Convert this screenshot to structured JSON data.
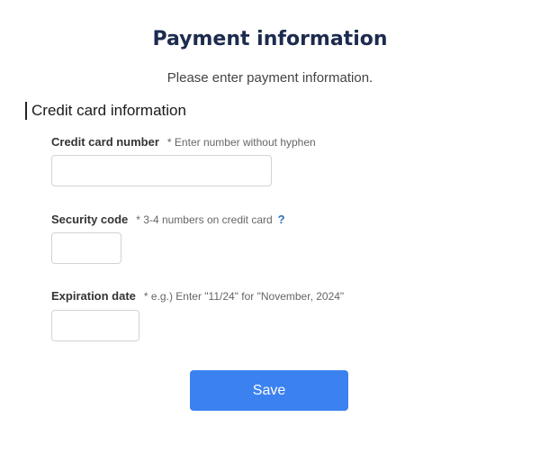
{
  "header": {
    "title": "Payment information",
    "subtitle": "Please enter payment information."
  },
  "section": {
    "heading": "Credit card information"
  },
  "fields": {
    "card_number": {
      "label": "Credit card number",
      "hint": "* Enter number without hyphen",
      "value": "",
      "placeholder": ""
    },
    "security_code": {
      "label": "Security code",
      "hint": "* 3-4 numbers on credit card",
      "help_icon": "?",
      "value": "",
      "placeholder": ""
    },
    "expiration_date": {
      "label": "Expiration date",
      "hint": "* e.g.) Enter \"11/24\" for \"November, 2024\"",
      "value": "",
      "placeholder": ""
    }
  },
  "actions": {
    "save_label": "Save"
  },
  "colors": {
    "title": "#1d2b4f",
    "accent_button": "#3b82f0",
    "help_icon": "#2f6fb5"
  }
}
